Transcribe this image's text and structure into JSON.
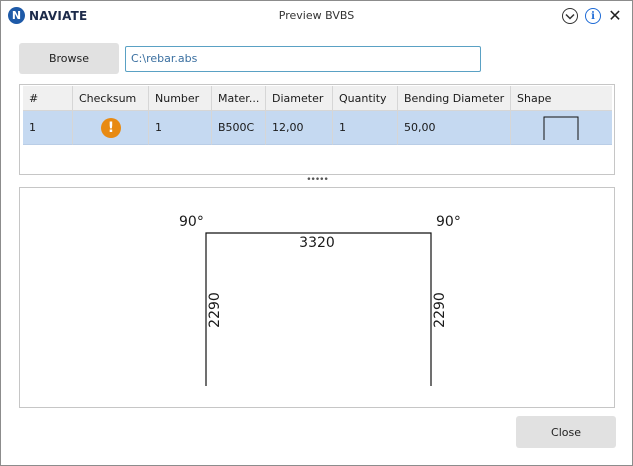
{
  "app": {
    "logo_text": "NAVIATE",
    "logo_mark": "N",
    "title": "Preview BVBS"
  },
  "titlebar": {
    "icons": [
      "chevron-down-icon",
      "info-icon",
      "close-icon"
    ],
    "info_glyph": "i",
    "close_glyph": "✕"
  },
  "toolbar": {
    "browse_label": "Browse",
    "file_path": "C:\\rebar.abs"
  },
  "table": {
    "columns": [
      "#",
      "Checksum",
      "Number",
      "Mater...",
      "Diameter",
      "Quantity",
      "Bending Diameter",
      "Shape"
    ],
    "rows": [
      {
        "index": "1",
        "checksum_icon": "warning-icon",
        "checksum_glyph": "!",
        "number": "1",
        "material": "B500C",
        "diameter": "12,00",
        "quantity": "1",
        "bending_diameter": "50,00",
        "shape_icon": "u-shape-icon"
      }
    ],
    "selected_row_color": "#c5d9f1"
  },
  "splitter": {
    "glyph": "•••••"
  },
  "drawing": {
    "left_angle": "90°",
    "right_angle": "90°",
    "top_length": "3320",
    "left_leg_length": "2290",
    "right_leg_length": "2290"
  },
  "footer": {
    "close_label": "Close"
  },
  "colors": {
    "accent": "#1e6bd6",
    "warning": "#e88a12",
    "button_bg": "#e1e1e1",
    "field_border": "#5aa1c4"
  }
}
